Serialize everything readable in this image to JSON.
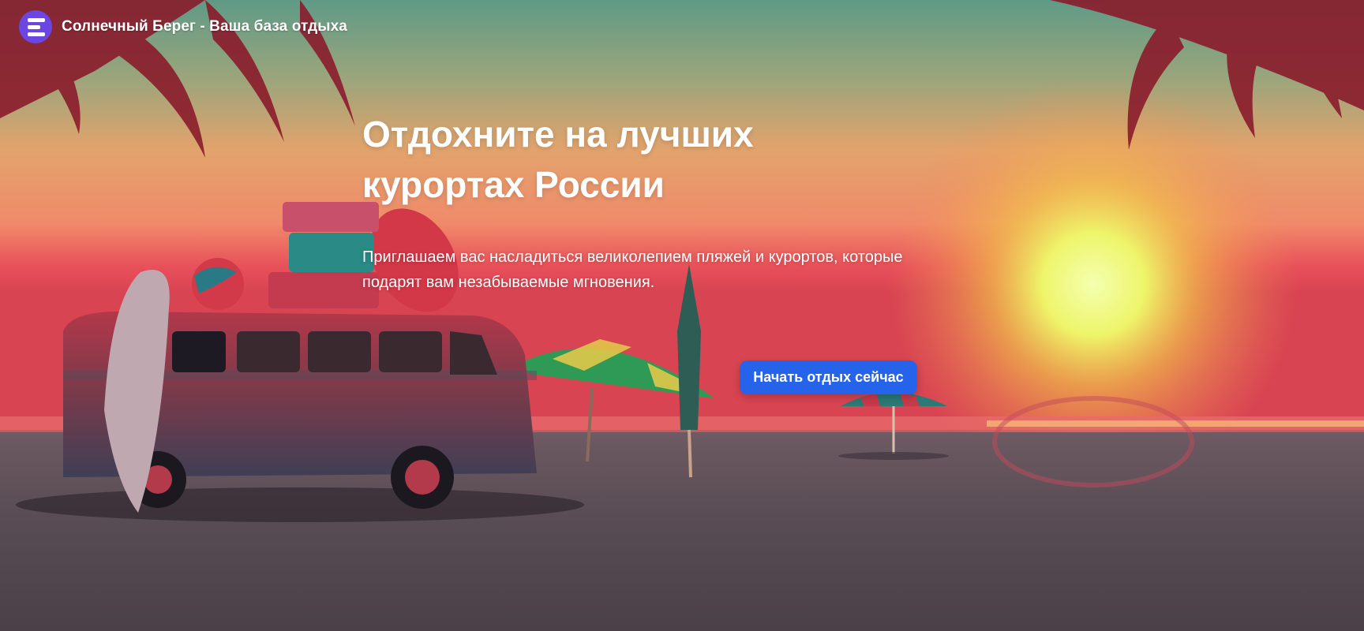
{
  "header": {
    "logo_icon": "hamburger-menu-icon",
    "logo_color": "#6b46e0",
    "site_title": "Солнечный Берег - Ваша база отдыха"
  },
  "hero": {
    "headline_line1": "Отдохните на лучших",
    "headline_line2": "курортах России",
    "lead": "Приглашаем вас насладиться великолепием пляжей и курортов, которые подарят вам незабываемые мгновения.",
    "cta_label": "Начать отдых сейчас",
    "cta_color": "#2563eb",
    "background_image": "sunset beach with retro van, surfboard, beach umbrellas and palm leaves"
  }
}
